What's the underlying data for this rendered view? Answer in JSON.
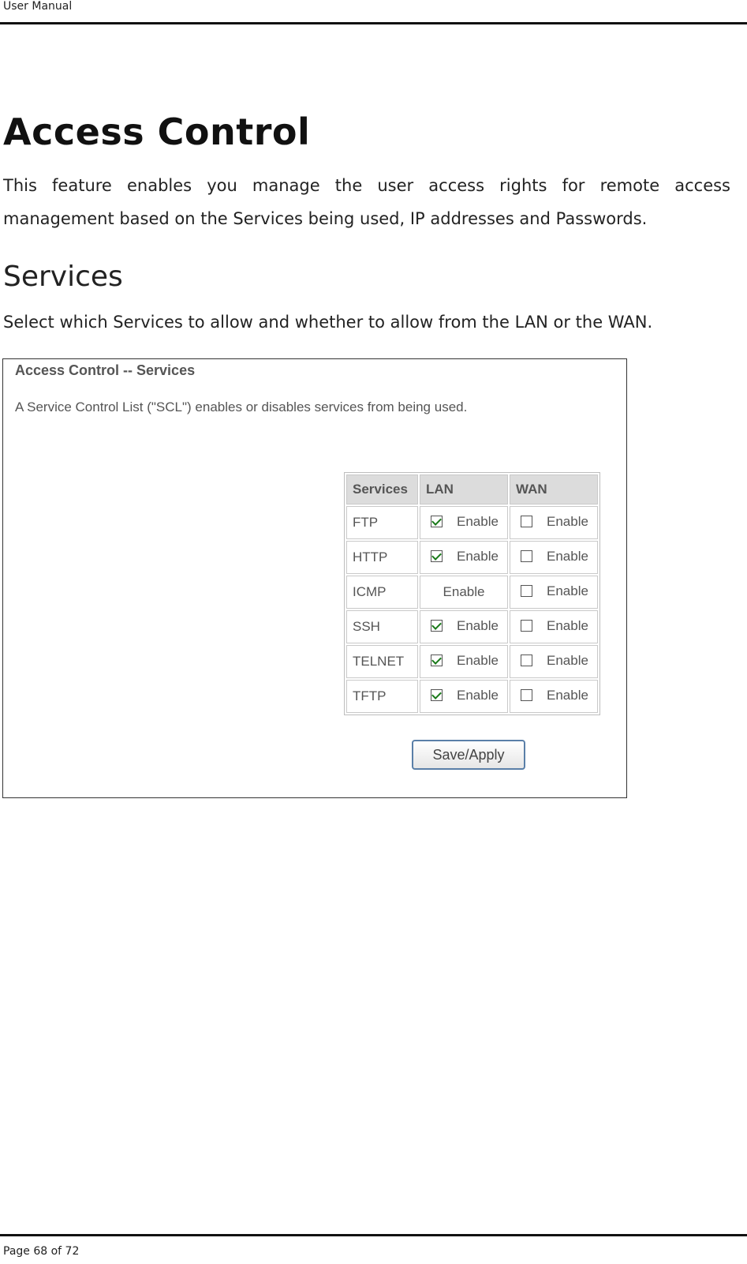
{
  "header": {
    "label": "User Manual"
  },
  "page": {
    "title": "Access Control",
    "intro": "This feature enables you manage the user access rights for remote access management based on the Services being used, IP addresses and Passwords.",
    "section_title": "Services",
    "section_desc": "Select which Services to allow and whether to allow from the LAN or the WAN."
  },
  "screenshot": {
    "title": "Access Control -- Services",
    "description": "A Service Control List (\"SCL\") enables or disables services from being used.",
    "table": {
      "headers": [
        "Services",
        "LAN",
        "WAN"
      ],
      "rows": [
        {
          "service": "FTP",
          "lan_label": "Enable",
          "lan_checked": true,
          "wan_label": "Enable",
          "wan_checked": false
        },
        {
          "service": "HTTP",
          "lan_label": "Enable",
          "lan_checked": true,
          "wan_label": "Enable",
          "wan_checked": false
        },
        {
          "service": "ICMP",
          "lan_label": "Enable",
          "lan_checked": null,
          "wan_label": "Enable",
          "wan_checked": false
        },
        {
          "service": "SSH",
          "lan_label": "Enable",
          "lan_checked": true,
          "wan_label": "Enable",
          "wan_checked": false
        },
        {
          "service": "TELNET",
          "lan_label": "Enable",
          "lan_checked": true,
          "wan_label": "Enable",
          "wan_checked": false
        },
        {
          "service": "TFTP",
          "lan_label": "Enable",
          "lan_checked": true,
          "wan_label": "Enable",
          "wan_checked": false
        }
      ]
    },
    "save_label": "Save/Apply"
  },
  "footer": {
    "page_label": "Page 68  of 72"
  }
}
